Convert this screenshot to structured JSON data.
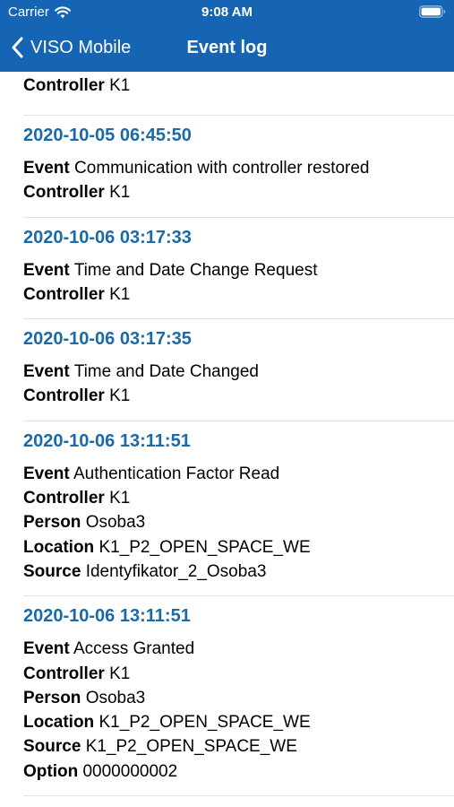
{
  "status_bar": {
    "carrier": "Carrier",
    "time": "9:08 AM"
  },
  "nav": {
    "back_label": "VISO Mobile",
    "title": "Event log"
  },
  "colors": {
    "nav_background": "#1565b4",
    "timestamp": "#1a69a8",
    "divider": "#e2e2e2"
  },
  "partial_entry": {
    "fields": [
      {
        "label": "Controller",
        "value": "K1"
      }
    ]
  },
  "events": [
    {
      "timestamp": "2020-10-05 06:45:50",
      "fields": [
        {
          "label": "Event",
          "value": "Communication with controller restored"
        },
        {
          "label": "Controller",
          "value": "K1"
        }
      ]
    },
    {
      "timestamp": "2020-10-06 03:17:33",
      "fields": [
        {
          "label": "Event",
          "value": "Time and Date Change Request"
        },
        {
          "label": "Controller",
          "value": "K1"
        }
      ]
    },
    {
      "timestamp": "2020-10-06 03:17:35",
      "fields": [
        {
          "label": "Event",
          "value": "Time and Date Changed"
        },
        {
          "label": "Controller",
          "value": "K1"
        }
      ]
    },
    {
      "timestamp": "2020-10-06 13:11:51",
      "fields": [
        {
          "label": "Event",
          "value": "Authentication Factor Read"
        },
        {
          "label": "Controller",
          "value": "K1"
        },
        {
          "label": "Person",
          "value": "Osoba3"
        },
        {
          "label": "Location",
          "value": "K1_P2_OPEN_SPACE_WE"
        },
        {
          "label": "Source",
          "value": "Identyfikator_2_Osoba3"
        }
      ]
    },
    {
      "timestamp": "2020-10-06 13:11:51",
      "fields": [
        {
          "label": "Event",
          "value": "Access Granted"
        },
        {
          "label": "Controller",
          "value": "K1"
        },
        {
          "label": "Person",
          "value": "Osoba3"
        },
        {
          "label": "Location",
          "value": "K1_P2_OPEN_SPACE_WE"
        },
        {
          "label": "Source",
          "value": "K1_P2_OPEN_SPACE_WE"
        },
        {
          "label": "Option",
          "value": "0000000002"
        }
      ]
    }
  ]
}
